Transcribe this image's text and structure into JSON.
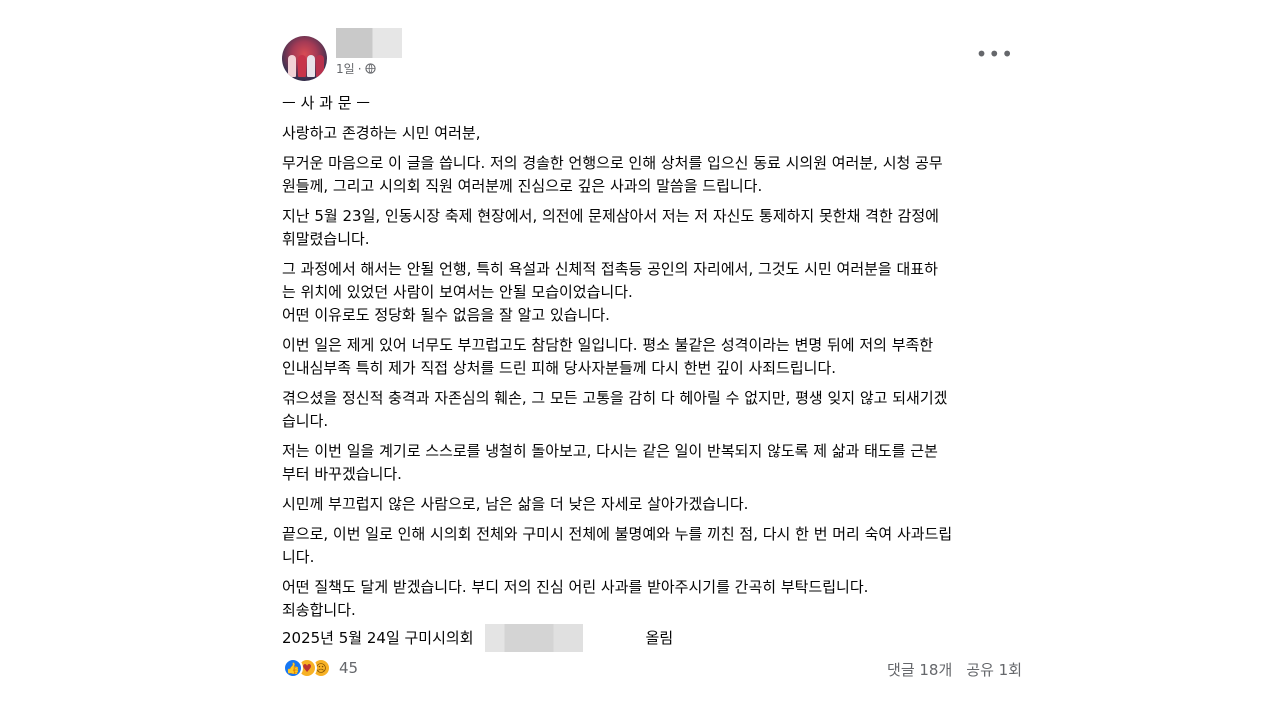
{
  "post": {
    "time": "1일",
    "separator": "·",
    "more_icon": "more-horizontal-icon",
    "privacy_icon": "globe-icon",
    "paragraphs": [
      "ㅡ 사 과 문 ㅡ",
      "사랑하고 존경하는 시민 여러분,",
      "무거운 마음으로 이 글을 씁니다. 저의 경솔한 언행으로 인해 상처를 입으신 동료 시의원 여러분, 시청 공무\n원들께, 그리고 시의회 직원 여러분께 진심으로 깊은 사과의 말씀을 드립니다.",
      "지난 5월 23일, 인동시장 축제 현장에서, 의전에 문제삼아서 저는 저 자신도 통제하지 못한채 격한 감정에\n휘말렸습니다.",
      "그 과정에서 해서는 안될 언행, 특히 욕설과 신체적 접촉등 공인의 자리에서, 그것도 시민 여러분을 대표하\n는 위치에 있었던 사람이 보여서는 안될 모습이었습니다.\n어떤 이유로도 정당화 될수 없음을 잘 알고 있습니다.",
      "이번 일은 제게 있어 너무도 부끄럽고도 참담한 일입니다. 평소 불같은 성격이라는 변명 뒤에 저의 부족한\n인내심부족 특히 제가 직접 상처를 드린 피해 당사자분들께 다시 한번 깊이 사죄드립니다.",
      "겪으셨을 정신적 충격과 자존심의 훼손, 그 모든 고통을 감히 다 헤아릴 수 없지만, 평생 잊지 않고 되새기겠\n습니다.",
      "저는 이번 일을 계기로 스스로를 냉철히 돌아보고, 다시는 같은 일이 반복되지 않도록 제 삶과 태도를 근본\n부터 바꾸겠습니다.",
      "시민께 부끄럽지 않은 사람으로, 남은 삶을 더 낮은 자세로 살아가겠습니다.",
      "끝으로, 이번 일로 인해 시의회 전체와 구미시 전체에 불명예와 누를 끼친 점, 다시 한 번 머리 숙여 사과드립\n니다.",
      "어떤 질책도 달게 받겠습니다. 부디 저의 진심 어린 사과를 받아주시기를 간곡히 부탁드립니다.\n죄송합니다."
    ],
    "signature_prefix": "2025년 5월 24일 구미시의회",
    "signature_suffix": "올림"
  },
  "footer": {
    "reaction_icons": [
      "like-icon",
      "care-icon",
      "sad-icon"
    ],
    "reaction_count": "45",
    "comments": "댓글 18개",
    "shares": "공유 1회"
  }
}
